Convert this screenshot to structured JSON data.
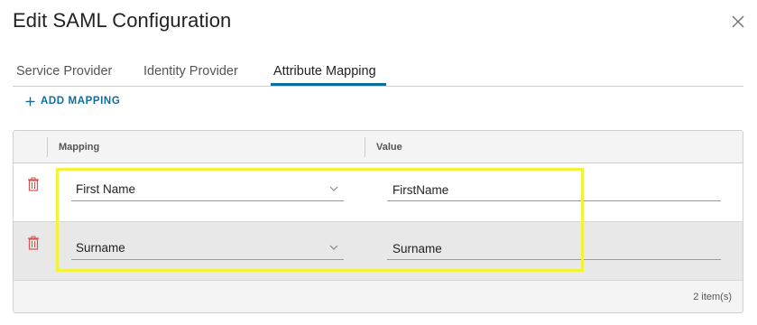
{
  "dialog": {
    "title": "Edit SAML Configuration"
  },
  "tabs": [
    {
      "label": "Service Provider",
      "active": false
    },
    {
      "label": "Identity Provider",
      "active": false
    },
    {
      "label": "Attribute Mapping",
      "active": true
    }
  ],
  "actions": {
    "add_mapping_label": "ADD MAPPING"
  },
  "grid": {
    "columns": [
      "Mapping",
      "Value"
    ],
    "rows": [
      {
        "mapping": "First Name",
        "value": "FirstName"
      },
      {
        "mapping": "Surname",
        "value": "Surname"
      }
    ],
    "footer_count": "2 item(s)"
  },
  "icons": {
    "close": "close-icon",
    "add": "plus-icon",
    "delete": "trash-icon",
    "dropdown": "chevron-down-icon"
  },
  "colors": {
    "accent": "#0f6d9b",
    "delete": "#d9534f",
    "highlight": "#f2f23a"
  }
}
